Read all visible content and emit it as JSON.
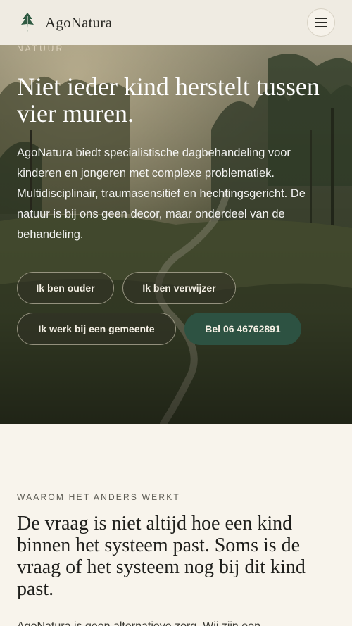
{
  "header": {
    "brand": "AgoNatura",
    "menu_icon": "hamburger-menu-icon",
    "logo_icon": "tree-logo-icon"
  },
  "hero": {
    "eyebrow": "NATUUR",
    "title": "Niet ieder kind herstelt tussen vier muren.",
    "text": "AgoNatura biedt specialistische dagbehandeling voor kinderen en jongeren met complexe problematiek. Multidisciplinair, traumasensitief en hechtingsgericht. De natuur is bij ons geen decor, maar onderdeel van de behandeling.",
    "buttons": {
      "parent": "Ik ben ouder",
      "referrer": "Ik ben verwijzer",
      "municipality": "Ik werk bij een gemeente",
      "call": "Bel 06 46762891"
    }
  },
  "why": {
    "eyebrow": "WAAROM HET ANDERS WERKT",
    "title": "De vraag is niet altijd hoe een kind binnen het systeem past. Soms is de vraag of het systeem nog bij dit kind past.",
    "text": "AgoNatura is geen alternatieve zorg. Wij zijn een"
  },
  "colors": {
    "header_bg": "#efebe2",
    "page_bg": "#f8f4ec",
    "accent_green": "#2d5242",
    "hero_text": "#ffffff"
  }
}
